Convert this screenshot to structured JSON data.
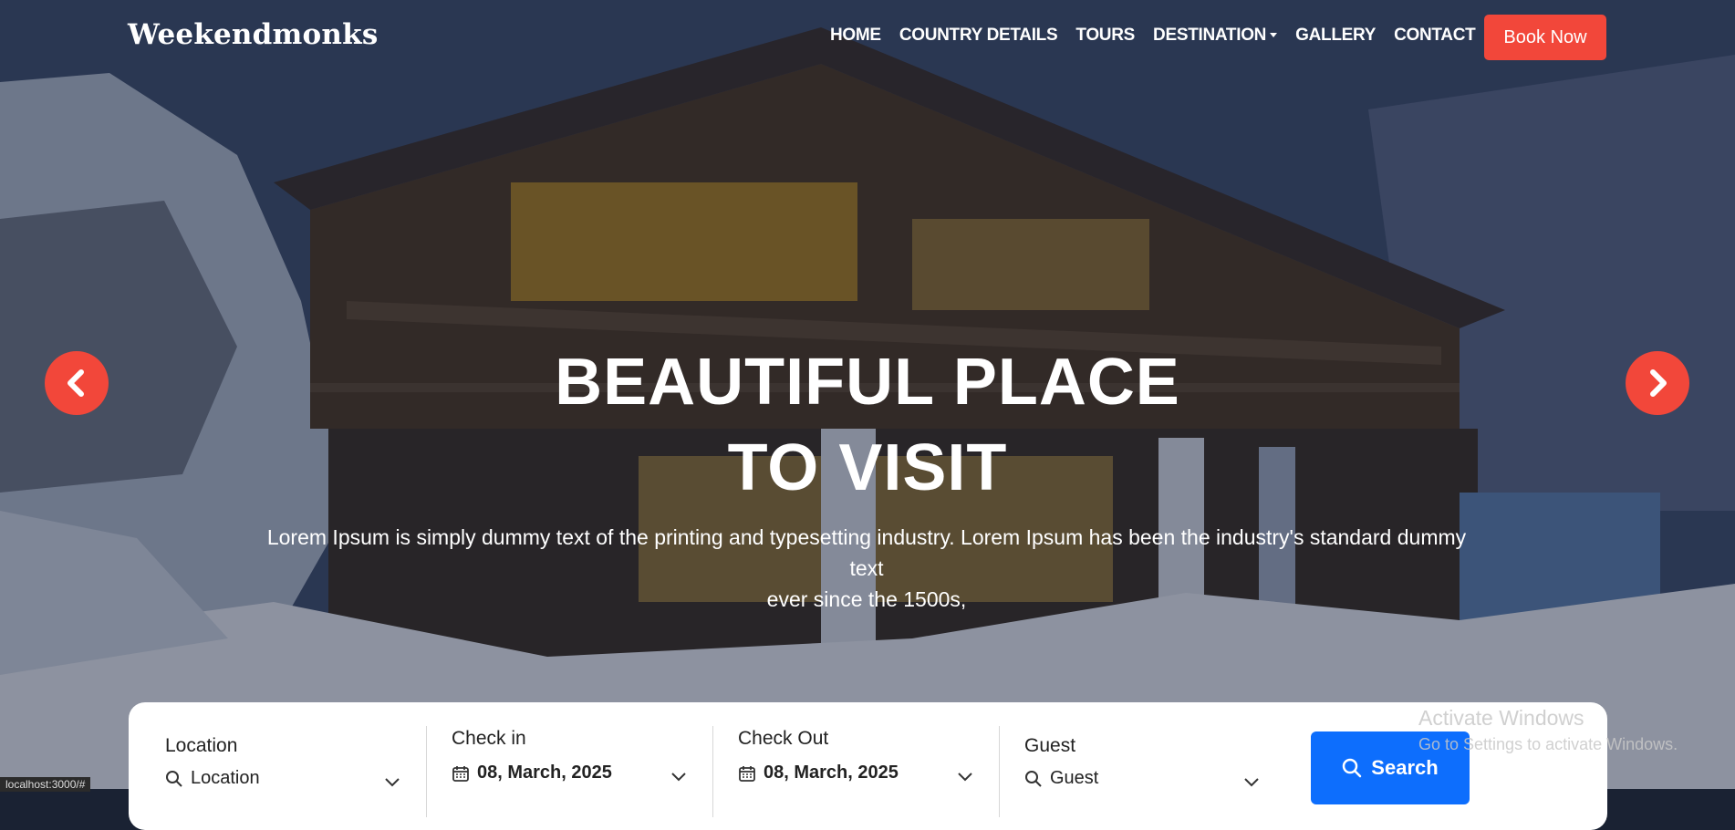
{
  "brand": {
    "logo_text": "Weekendmonks"
  },
  "nav": {
    "items": [
      {
        "label": "HOME"
      },
      {
        "label": "COUNTRY DETAILS"
      },
      {
        "label": "TOURS"
      },
      {
        "label": "DESTINATION",
        "has_dropdown": true
      },
      {
        "label": "GALLERY"
      },
      {
        "label": "CONTACT"
      }
    ],
    "book_label": "Book Now"
  },
  "hero": {
    "title_line1": "BEAUTIFUL PLACE",
    "title_line2": "TO VISIT",
    "subtitle_line1": "Lorem Ipsum is simply dummy text of the printing and typesetting industry. Lorem Ipsum has been the industry's standard dummy text",
    "subtitle_line2": "ever since the 1500s,",
    "prev_icon": "chevron-left-icon",
    "next_icon": "chevron-right-icon"
  },
  "search": {
    "location": {
      "label": "Location",
      "value": "Location"
    },
    "checkin": {
      "label": "Check in",
      "value": "08, March, 2025"
    },
    "checkout": {
      "label": "Check Out",
      "value": "08, March, 2025"
    },
    "guest": {
      "label": "Guest",
      "value": "Guest"
    },
    "button_label": "Search"
  },
  "system": {
    "watermark_title": "Activate Windows",
    "watermark_sub": "Go to Settings to activate Windows.",
    "status_url": "localhost:3000/#"
  },
  "colors": {
    "accent": "#f2473a",
    "primary": "#0d6efd"
  }
}
